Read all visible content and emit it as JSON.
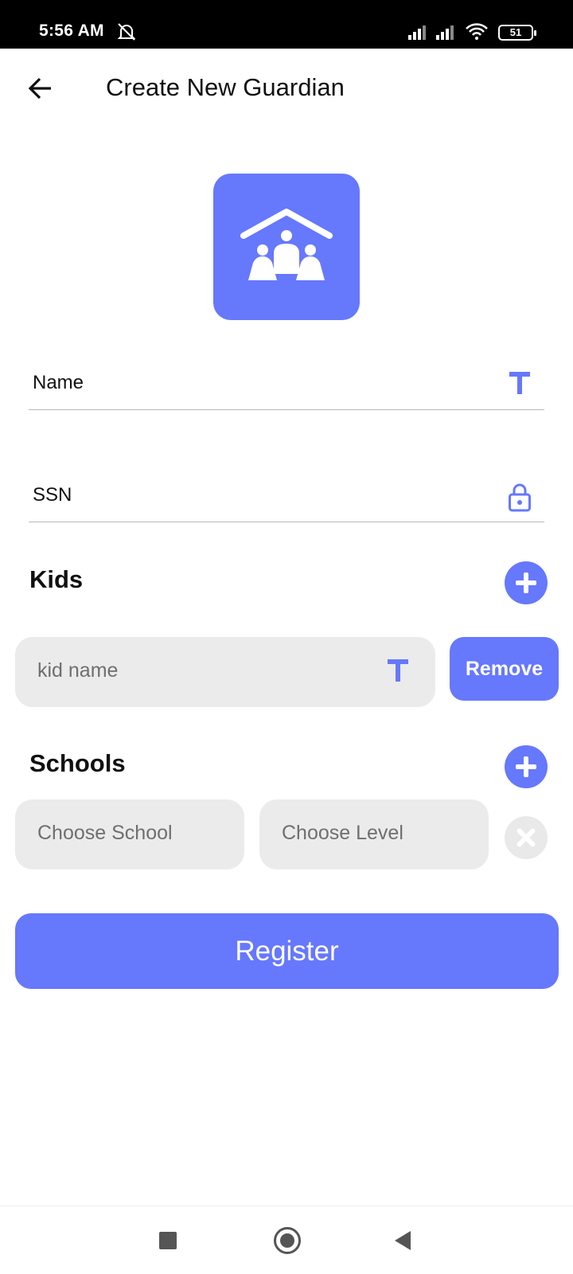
{
  "status_bar": {
    "time": "5:56 AM",
    "battery": "51",
    "icons": [
      "mute-bell-icon",
      "signal-icon",
      "signal-icon",
      "wifi-icon",
      "battery-icon"
    ]
  },
  "app_bar": {
    "title": "Create New Guardian",
    "back_icon": "arrow-left-icon"
  },
  "logo": {
    "icon": "family-house-icon",
    "color": "#6678fc"
  },
  "form": {
    "name_label": "Name",
    "name_icon": "text-t-icon",
    "ssn_label": "SSN",
    "ssn_icon": "lock-icon"
  },
  "kids": {
    "title": "Kids",
    "add_icon": "plus-icon",
    "kid_placeholder": "kid name",
    "kid_icon": "text-t-icon",
    "remove_label": "Remove"
  },
  "schools": {
    "title": "Schools",
    "add_icon": "plus-icon",
    "school_placeholder": "Choose School",
    "level_placeholder": "Choose Level",
    "clear_icon": "close-icon"
  },
  "register_label": "Register",
  "nav_bar": {
    "icons": [
      "recent-apps-icon",
      "home-icon",
      "back-icon"
    ]
  },
  "colors": {
    "accent": "#6678fc",
    "input_bg": "#ebebeb",
    "placeholder": "#6f6f6f"
  }
}
